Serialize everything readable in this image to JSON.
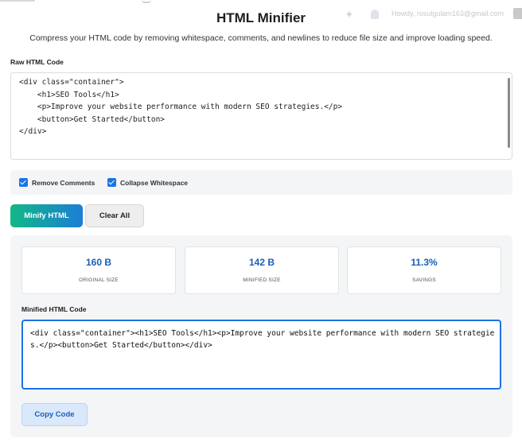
{
  "topbar": {
    "account_text": "Howdy, rosulgulam163@gmail.com"
  },
  "header": {
    "title": "HTML Minifier",
    "subtitle": "Compress your HTML code by removing whitespace, comments, and newlines to reduce file size and improve loading speed."
  },
  "raw_input": {
    "label": "Raw HTML Code",
    "value": "<div class=\"container\">\n    <h1>SEO Tools</h1>\n    <p>Improve your website performance with modern SEO strategies.</p>\n    <button>Get Started</button>\n</div>"
  },
  "options": {
    "remove_comments": {
      "label": "Remove Comments",
      "checked": true
    },
    "collapse_whitespace": {
      "label": "Collapse Whitespace",
      "checked": true
    }
  },
  "actions": {
    "minify_label": "Minify HTML",
    "clear_label": "Clear All"
  },
  "stats": [
    {
      "value": "160 B",
      "caption": "ORIGINAL SIZE"
    },
    {
      "value": "142 B",
      "caption": "MINIFIED SIZE"
    },
    {
      "value": "11.3%",
      "caption": "SAVINGS"
    }
  ],
  "output": {
    "label": "Minified HTML Code",
    "value": "<div class=\"container\"><h1>SEO Tools</h1><p>Improve your website performance with modern SEO strategies.</p><button>Get Started</button></div>",
    "copy_label": "Copy Code"
  },
  "icons": {
    "sparkle": "sparkle-icon",
    "notification": "bell-icon",
    "checkbox": "check-icon"
  },
  "colors": {
    "accent": "#1a73e8",
    "stat_value": "#1a5fb4",
    "minify_gradient_start": "#12b886",
    "minify_gradient_end": "#1c7ed6"
  }
}
